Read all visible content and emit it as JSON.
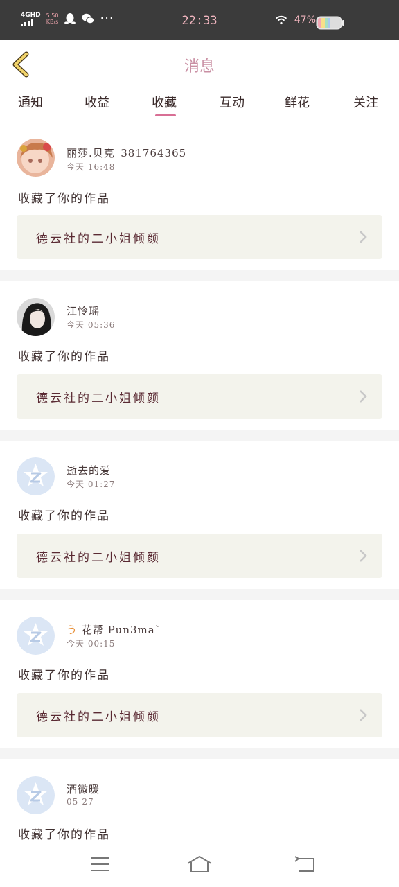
{
  "status_bar": {
    "network_type": "4GHD",
    "net_speed_value": "5.50",
    "net_speed_unit": "KB/s",
    "time": "22:33",
    "battery_percent": "47%",
    "battery_level": 0.47,
    "icons": [
      "qq-icon",
      "wechat-icon",
      "more-dots-icon",
      "wifi-icon",
      "battery-icon"
    ]
  },
  "header": {
    "title": "消息",
    "back_icon": "chevron-left-icon",
    "accent_color": "#d86f95"
  },
  "tabs": [
    {
      "label": "通知",
      "active": false
    },
    {
      "label": "收益",
      "active": false
    },
    {
      "label": "收藏",
      "active": true
    },
    {
      "label": "互动",
      "active": false
    },
    {
      "label": "鲜花",
      "active": false
    },
    {
      "label": "关注",
      "active": false
    }
  ],
  "messages": [
    {
      "user": "丽莎.贝克_381764365",
      "time": "今天 16:48",
      "action": "收藏了你的作品",
      "work_title": "德云社的二小姐倾颜",
      "avatar": "anime-girl-avatar"
    },
    {
      "user": "江怜瑶",
      "time": "今天 05:36",
      "action": "收藏了你的作品",
      "work_title": "德云社的二小姐倾颜",
      "avatar": "girl-photo-avatar"
    },
    {
      "user": "逝去的爱",
      "time": "今天 01:27",
      "action": "收藏了你的作品",
      "work_title": "德云社的二小姐倾颜",
      "avatar": "default-avatar"
    },
    {
      "user_prefix": "う",
      "user": "花帮 Pun3ma˘",
      "time": "今天 00:15",
      "action": "收藏了你的作品",
      "work_title": "德云社的二小姐倾颜",
      "avatar": "default-avatar"
    },
    {
      "user": "酒微暖",
      "time": "05-27",
      "action": "收藏了你的作品",
      "avatar": "default-avatar"
    }
  ],
  "nav_bar": {
    "icons": [
      "menu-icon",
      "home-icon",
      "back-icon"
    ]
  }
}
